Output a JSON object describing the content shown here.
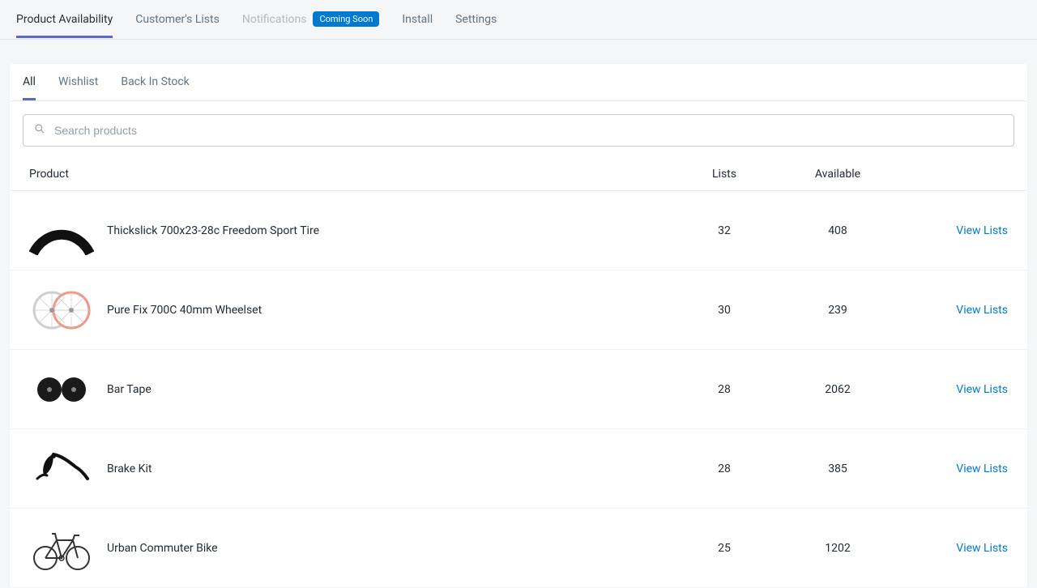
{
  "topNav": {
    "items": [
      {
        "label": "Product Availability",
        "active": true
      },
      {
        "label": "Customer's Lists"
      },
      {
        "label": "Notifications",
        "disabled": true,
        "badge": "Coming Soon"
      },
      {
        "label": "Install"
      },
      {
        "label": "Settings"
      }
    ]
  },
  "subTabs": {
    "items": [
      {
        "label": "All",
        "active": true
      },
      {
        "label": "Wishlist"
      },
      {
        "label": "Back In Stock"
      }
    ]
  },
  "search": {
    "placeholder": "Search products"
  },
  "tableHead": {
    "product": "Product",
    "lists": "Lists",
    "available": "Available"
  },
  "actionLabel": "View Lists",
  "products": [
    {
      "name": "Thickslick 700x23-28c Freedom Sport Tire",
      "lists": "32",
      "available": "408",
      "icon": "tire"
    },
    {
      "name": "Pure Fix 700C 40mm Wheelset",
      "lists": "30",
      "available": "239",
      "icon": "wheelset"
    },
    {
      "name": "Bar Tape",
      "lists": "28",
      "available": "2062",
      "icon": "bartape"
    },
    {
      "name": "Brake Kit",
      "lists": "28",
      "available": "385",
      "icon": "brake"
    },
    {
      "name": "Urban Commuter Bike",
      "lists": "25",
      "available": "1202",
      "icon": "bike"
    }
  ]
}
